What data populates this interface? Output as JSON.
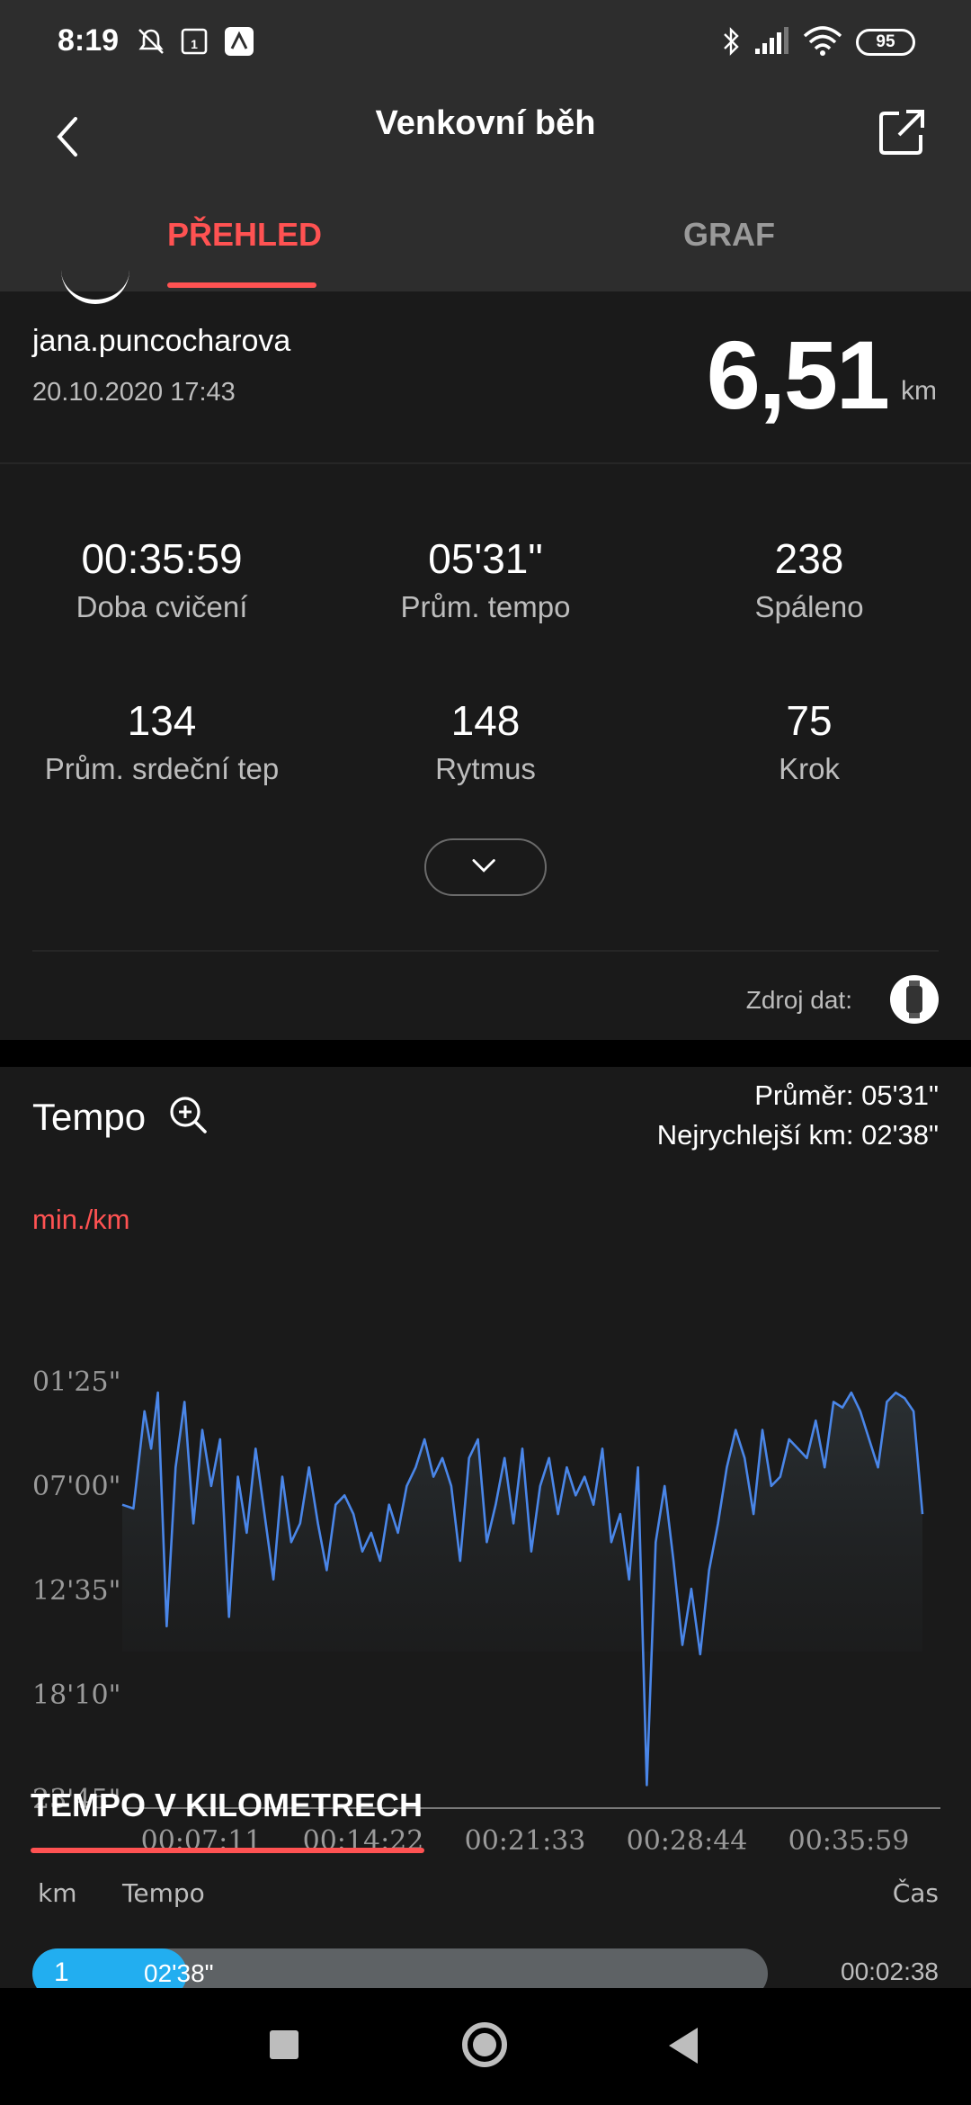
{
  "status_bar": {
    "time": "8:19",
    "battery": "95",
    "icons": [
      "bell-off-icon",
      "calendar-icon",
      "app-icon",
      "bluetooth-icon",
      "signal-icon",
      "wifi-icon",
      "battery-icon"
    ]
  },
  "header": {
    "title": "Venkovní běh",
    "tabs": [
      {
        "label": "PŘEHLED",
        "active": true
      },
      {
        "label": "GRAF",
        "active": false
      }
    ]
  },
  "summary": {
    "username": "jana.puncocharova",
    "date": "20.10.2020 17:43",
    "distance": "6,51",
    "unit": "km"
  },
  "stats": [
    {
      "value": "00:35:59",
      "label": "Doba cvičení"
    },
    {
      "value": "05'31\"",
      "label": "Prům. tempo"
    },
    {
      "value": "238",
      "label": "Spáleno"
    },
    {
      "value": "134",
      "label": "Prům. srdeční tep"
    },
    {
      "value": "148",
      "label": "Rytmus"
    },
    {
      "value": "75",
      "label": "Krok"
    }
  ],
  "data_source": {
    "label": "Zdroj dat:"
  },
  "tempo": {
    "title": "Tempo",
    "average": "Průměr: 05'31\"",
    "fastest": "Nejrychlejší km: 02'38\"",
    "y_unit": "min./km"
  },
  "chart_data": {
    "type": "area",
    "title": "Tempo",
    "ylabel": "min./km",
    "y_ticks": [
      "01'25\"",
      "07'00\"",
      "12'35\"",
      "18'10\"",
      "23'45\""
    ],
    "x_ticks": [
      "00:07:11",
      "00:14:22",
      "00:21:33",
      "00:28:44",
      "00:35:59"
    ],
    "y_inverted": true,
    "y_range_min": [
      1.42,
      23.75
    ],
    "x_range_min": [
      0,
      36
    ],
    "series": [
      {
        "color": "#4a86e8",
        "x_min": [
          0,
          0.5,
          1,
          1.3,
          1.6,
          2.0,
          2.4,
          2.8,
          3.2,
          3.6,
          4.0,
          4.4,
          4.8,
          5.2,
          5.6,
          6.0,
          6.4,
          6.8,
          7.2,
          7.6,
          8.0,
          8.4,
          8.8,
          9.2,
          9.6,
          10.0,
          10.4,
          10.8,
          11.2,
          11.6,
          12.0,
          12.4,
          12.8,
          13.2,
          13.6,
          14.0,
          14.4,
          14.8,
          15.2,
          15.6,
          16.0,
          16.4,
          16.8,
          17.2,
          17.6,
          18.0,
          18.4,
          18.8,
          19.2,
          19.6,
          20.0,
          20.4,
          20.8,
          21.2,
          21.6,
          22.0,
          22.4,
          22.8,
          23.2,
          23.6,
          24.0,
          24.4,
          24.8,
          25.2,
          25.6,
          26.0,
          26.4,
          26.8,
          27.2,
          27.6,
          28.0,
          28.4,
          28.8,
          29.2,
          29.6,
          30.0,
          30.4,
          30.8,
          31.2,
          31.6,
          32.0,
          32.4,
          32.8,
          33.2,
          33.6,
          34.0,
          34.4,
          34.8,
          35.2,
          35.6,
          36.0
        ],
        "y_min": [
          8.0,
          8.2,
          3.0,
          5.0,
          2.0,
          14.5,
          6.0,
          2.5,
          9.0,
          4.0,
          7.0,
          4.5,
          14.0,
          6.5,
          9.5,
          5.0,
          8.5,
          12.0,
          6.5,
          10.0,
          9.0,
          6.0,
          9.0,
          11.5,
          8.0,
          7.5,
          8.5,
          10.5,
          9.5,
          11.0,
          8.0,
          9.5,
          7.0,
          6.0,
          4.5,
          6.5,
          5.5,
          7.0,
          11.0,
          5.5,
          4.5,
          10.0,
          8.0,
          5.5,
          9.0,
          5.0,
          10.5,
          7.0,
          5.5,
          8.5,
          6.0,
          7.5,
          6.5,
          8.0,
          5.0,
          10.0,
          8.5,
          12.0,
          6.0,
          23.0,
          10.0,
          7.0,
          11.0,
          15.5,
          12.5,
          16.0,
          11.5,
          9.0,
          6.0,
          4.0,
          5.5,
          8.5,
          4.0,
          7.0,
          6.5,
          4.5,
          5.0,
          5.5,
          3.5,
          6.0,
          2.5,
          2.8,
          2.0,
          3.0,
          4.5,
          6.0,
          2.5,
          2.0,
          2.3,
          3.0,
          8.5
        ]
      }
    ]
  },
  "km_splits": {
    "title": "TEMPO V KILOMETRECH",
    "columns": [
      "km",
      "Tempo",
      "Čas"
    ],
    "rows": [
      {
        "km": "1",
        "tempo": "02'38\"",
        "time": "00:02:38",
        "fill_fraction": 0.21
      }
    ]
  },
  "nav": {
    "buttons": [
      "recents-button",
      "home-button",
      "back-button"
    ]
  }
}
